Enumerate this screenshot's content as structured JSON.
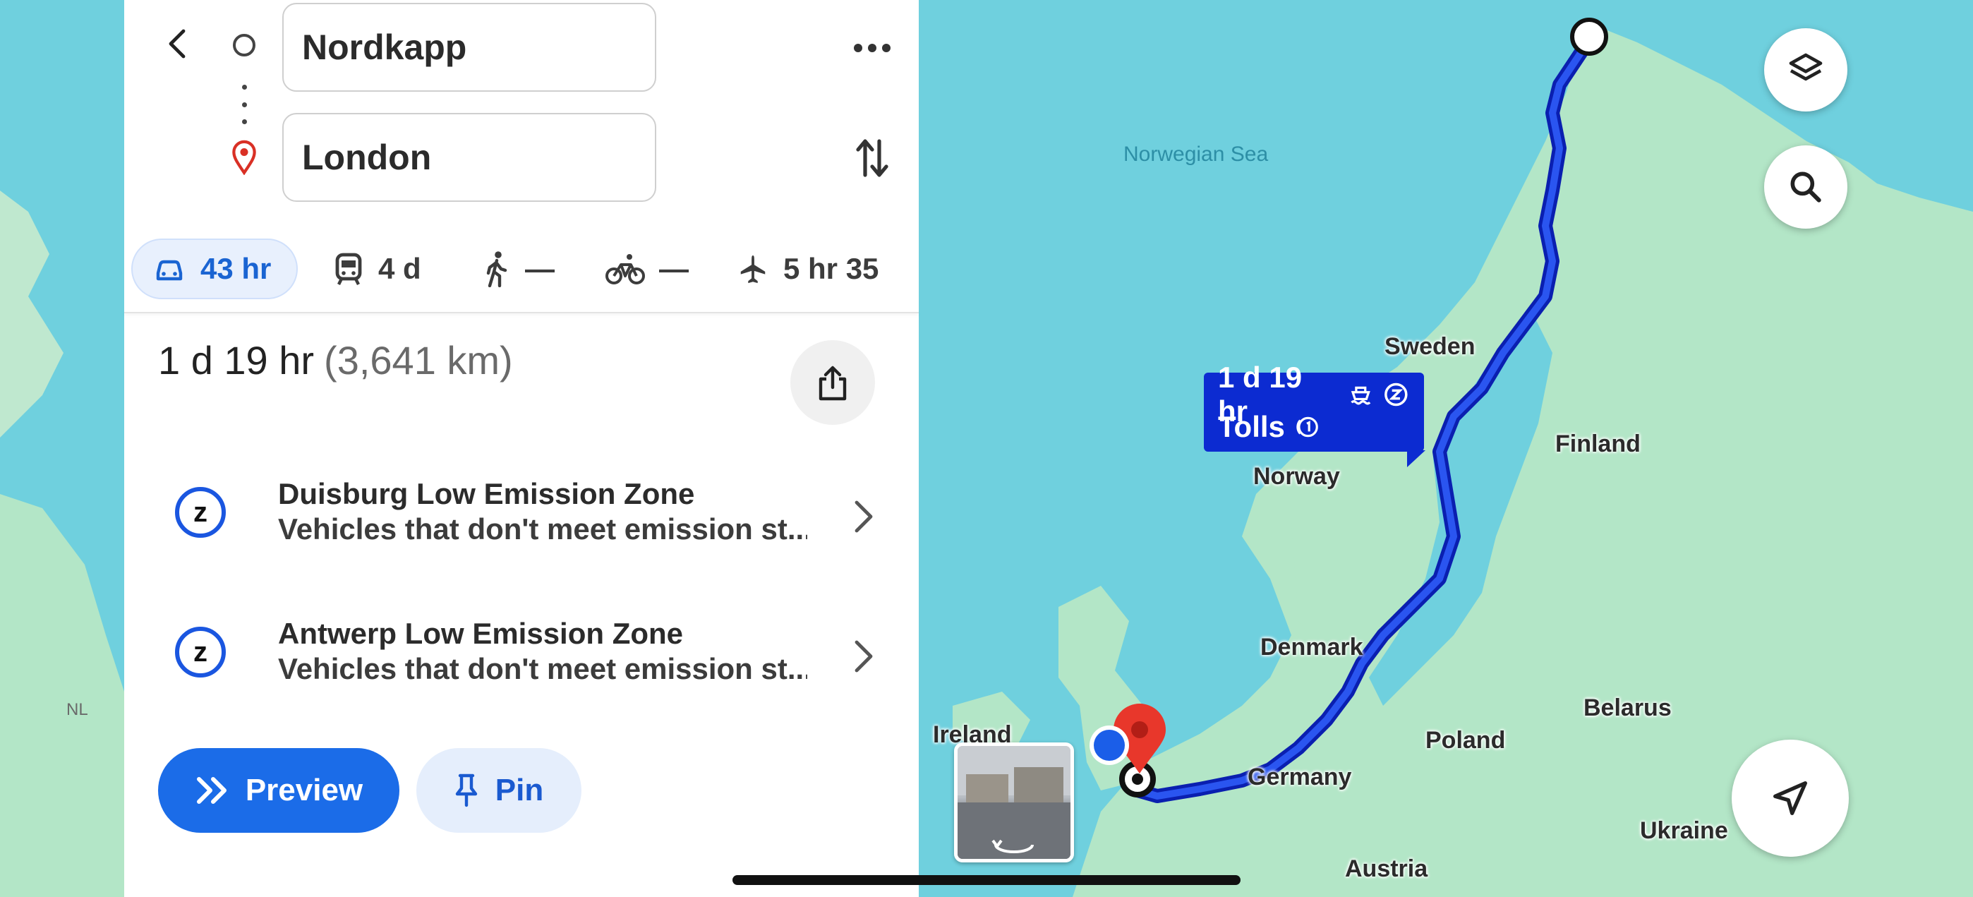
{
  "search": {
    "origin": "Nordkapp",
    "destination": "London"
  },
  "modes": [
    {
      "icon": "car-icon",
      "label": "43 hr",
      "active": true
    },
    {
      "icon": "train-icon",
      "label": "4 d"
    },
    {
      "icon": "walk-icon",
      "label": "—"
    },
    {
      "icon": "bike-icon",
      "label": "—"
    },
    {
      "icon": "plane-icon",
      "label": "5 hr 35"
    }
  ],
  "route": {
    "duration": "1 d 19 hr",
    "distance": "(3,641 km)"
  },
  "zones": [
    {
      "title": "Duisburg Low Emission Zone",
      "description": "Vehicles that don't meet emission st..."
    },
    {
      "title": "Antwerp Low Emission Zone",
      "description": "Vehicles that don't meet emission st..."
    }
  ],
  "actions": {
    "preview": "Preview",
    "pin": "Pin"
  },
  "map": {
    "callout_time": "1 d 19 hr",
    "callout_tolls": "Tolls",
    "labels": {
      "norwegian_sea": "Norwegian Sea",
      "sweden": "Sweden",
      "finland": "Finland",
      "norway": "Norway",
      "denmark": "Denmark",
      "ireland": "Ireland",
      "germany": "Germany",
      "poland": "Poland",
      "belarus": "Belarus",
      "ukraine": "Ukraine",
      "austria": "Austria",
      "nl": "NL"
    },
    "colors": {
      "water": "#6fd0de",
      "land": "#b3e6c7",
      "route": "#1b3ce0",
      "accent": "#1b6ce8"
    }
  }
}
